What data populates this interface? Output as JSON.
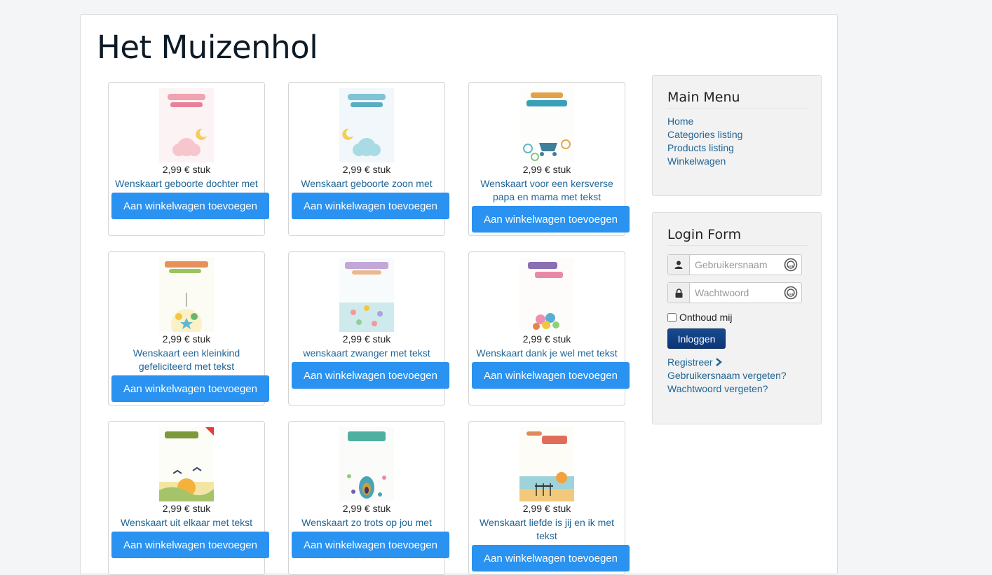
{
  "site": {
    "title": "Het Muizenhol"
  },
  "products": [
    {
      "price": "2,99 € stuk",
      "title": "Wenskaart geboorte dochter met tekst",
      "button": "Aan winkelwagen toevoegen",
      "art": "pink"
    },
    {
      "price": "2,99 € stuk",
      "title": "Wenskaart geboorte zoon met tekst",
      "button": "Aan winkelwagen toevoegen",
      "art": "blue"
    },
    {
      "price": "2,99 € stuk",
      "title": "Wenskaart voor een kersverse papa en mama met tekst",
      "button": "Aan winkelwagen toevoegen",
      "art": "teal"
    },
    {
      "price": "2,99 € stuk",
      "title": "Wenskaart een kleinkind gefeliciteerd met tekst",
      "button": "Aan winkelwagen toevoegen",
      "art": "rainbow"
    },
    {
      "price": "2,99 € stuk",
      "title": "wenskaart zwanger met tekst",
      "button": "Aan winkelwagen toevoegen",
      "art": "pastel"
    },
    {
      "price": "2,99 € stuk",
      "title": "Wenskaart dank je wel met tekst",
      "button": "Aan winkelwagen toevoegen",
      "art": "floral"
    },
    {
      "price": "2,99 € stuk",
      "title": "Wenskaart uit elkaar met tekst",
      "button": "Aan winkelwagen toevoegen",
      "art": "sunset"
    },
    {
      "price": "2,99 € stuk",
      "title": "Wenskaart zo trots op jou met tekst",
      "button": "Aan winkelwagen toevoegen",
      "art": "peacock"
    },
    {
      "price": "2,99 € stuk",
      "title": "Wenskaart liefde is jij en ik met tekst",
      "button": "Aan winkelwagen toevoegen",
      "art": "beach"
    }
  ],
  "main_menu": {
    "title": "Main Menu",
    "items": [
      "Home",
      "Categories listing",
      "Products listing",
      "Winkelwagen"
    ]
  },
  "login": {
    "title": "Login Form",
    "username_placeholder": "Gebruikersnaam",
    "password_placeholder": "Wachtwoord",
    "remember_label": "Onthoud mij",
    "submit_label": "Inloggen",
    "register_label": "Registreer",
    "forgot_username": "Gebruikersnaam vergeten?",
    "forgot_password": "Wachtwoord vergeten?"
  }
}
